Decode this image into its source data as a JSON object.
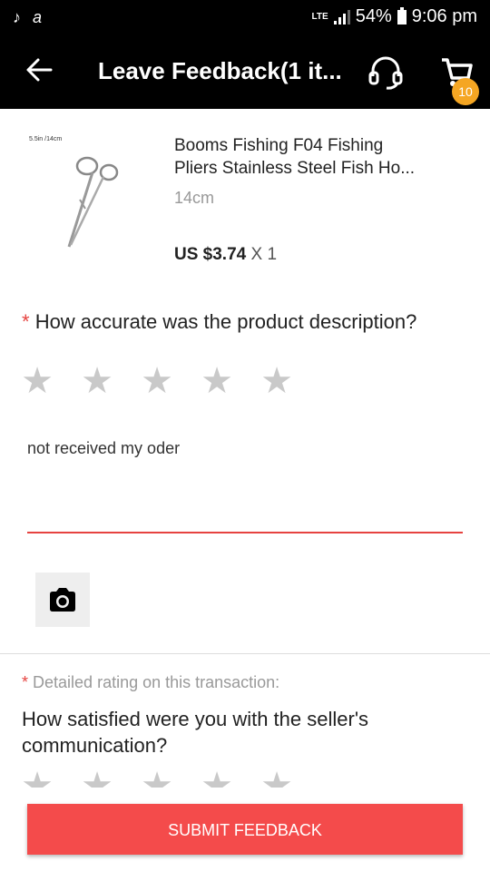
{
  "status_bar": {
    "network": "LTE",
    "battery": "54%",
    "time": "9:06 pm"
  },
  "header": {
    "title": "Leave Feedback(1 it...",
    "cart_count": "10",
    "icons": [
      "back-arrow-icon",
      "headset-icon",
      "cart-icon"
    ]
  },
  "product": {
    "size_text": "5.5in /14cm",
    "name_line1": "Booms Fishing F04 Fishing",
    "name_line2": "Pliers Stainless Steel Fish Ho...",
    "variant": "14cm",
    "price": "US $3.74",
    "quantity": " X 1"
  },
  "description_rating": {
    "required_mark": "*",
    "question": "How accurate was the product description?",
    "stars": [
      "★",
      "★",
      "★",
      "★",
      "★"
    ],
    "rating": 0
  },
  "comment": {
    "value": "not received my oder"
  },
  "detailed_rating": {
    "required_mark": "*",
    "label": "Detailed rating on this transaction:",
    "question": "How satisfied were you with the seller's communication?",
    "stars": [
      "★",
      "★",
      "★",
      "★",
      "★"
    ]
  },
  "submit_label": "SUBMIT FEEDBACK",
  "colors": {
    "accent": "#e64340",
    "submit": "#f44b4b",
    "badge": "#f5a623",
    "star_inactive": "#c9c9c9"
  }
}
